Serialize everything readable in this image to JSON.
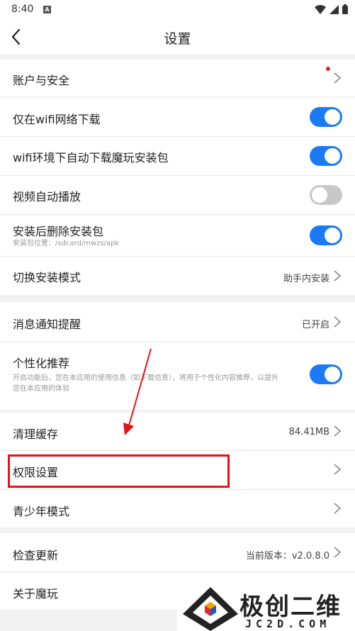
{
  "status_bar": {
    "time": "8:40",
    "notification_icon": "A",
    "icons": [
      "wifi-icon",
      "signal-icon",
      "battery-icon"
    ]
  },
  "header": {
    "title": "设置",
    "back_icon": "chevron-left-icon"
  },
  "settings": {
    "account": {
      "label": "账户与安全",
      "has_red_dot": true
    },
    "wifi_download_only": {
      "label": "仅在wifi网络下载",
      "enabled": true
    },
    "wifi_auto_download": {
      "label": "wifi环境下自动下载魔玩安装包",
      "enabled": true
    },
    "video_autoplay": {
      "label": "视频自动播放",
      "enabled": false
    },
    "delete_after_install": {
      "label": "安装后删除安装包",
      "sublabel": "安装包位置：/sdcard/mwzs/apk",
      "enabled": true
    },
    "install_mode": {
      "label": "切换安装模式",
      "value": "助手内安装"
    },
    "notifications": {
      "label": "消息通知提醒",
      "value": "已开启"
    },
    "personalized": {
      "label": "个性化推荐",
      "sublabel_line1": "开启功能后，您在本应用的使用信息（如下载信息），将用于个性化内容推荐，以提升",
      "sublabel_line2": "您在本应用的体验",
      "enabled": true
    },
    "clear_cache": {
      "label": "清理缓存",
      "value": "84.41MB"
    },
    "permissions": {
      "label": "权限设置"
    },
    "teen_mode": {
      "label": "青少年模式"
    },
    "check_update": {
      "label": "检查更新",
      "value": "当前版本：v2.0.8.0"
    },
    "about": {
      "label": "关于魔玩"
    }
  },
  "watermark": {
    "text": "极创二维",
    "subtext": "JC2D.COM"
  },
  "colors": {
    "toggle_on": "#1a7af8",
    "toggle_off": "#c8c8c8",
    "highlight": "#e8101a",
    "red_dot": "#e8242a"
  }
}
